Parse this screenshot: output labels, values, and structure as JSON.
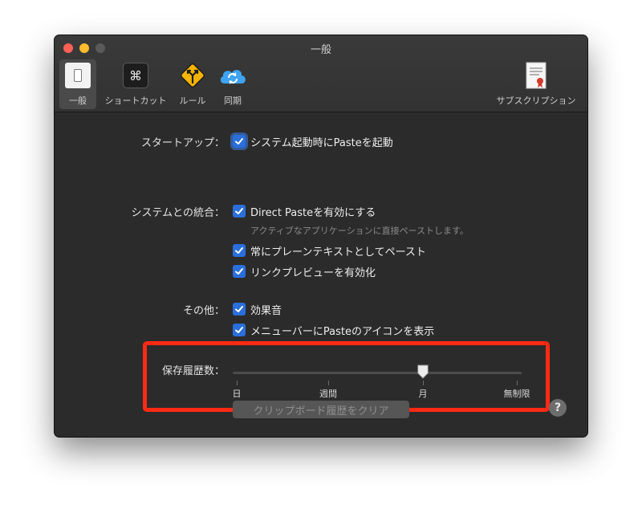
{
  "window": {
    "title": "一般"
  },
  "toolbar": {
    "items": [
      {
        "label": "一般",
        "icon": "general-switch-icon",
        "selected": true
      },
      {
        "label": "ショートカット",
        "icon": "command-key-icon",
        "selected": false
      },
      {
        "label": "ルール",
        "icon": "road-sign-icon",
        "selected": false
      },
      {
        "label": "同期",
        "icon": "cloud-sync-icon",
        "selected": false
      },
      {
        "label": "サブスクリプション",
        "icon": "certificate-icon",
        "selected": false
      }
    ]
  },
  "settings": {
    "startup": {
      "label": "スタートアップ：",
      "options": [
        {
          "text": "システム起動時にPasteを起動",
          "checked": true
        }
      ]
    },
    "integration": {
      "label": "システムとの統合：",
      "options": [
        {
          "text": "Direct Pasteを有効にする",
          "checked": true,
          "sub": "アクティブなアプリケーションに直接ペーストします。"
        },
        {
          "text": "常にプレーンテキストとしてペースト",
          "checked": true
        },
        {
          "text": "リンクプレビューを有効化",
          "checked": true
        }
      ]
    },
    "other": {
      "label": "その他：",
      "options": [
        {
          "text": "効果音",
          "checked": true
        },
        {
          "text": "メニューバーにPasteのアイコンを表示",
          "checked": true
        }
      ]
    },
    "history": {
      "label": "保存履歴数：",
      "ticks": [
        "日",
        "週間",
        "月",
        "無制限"
      ],
      "selected_index": 2,
      "selected_label": "月"
    },
    "clear_button": "クリップボード履歴をクリア",
    "help_button": "?"
  },
  "colors": {
    "window_bg": "#2b2b2b",
    "checkbox_blue": "#2a6fdb",
    "highlight_red": "#ff2a14"
  }
}
